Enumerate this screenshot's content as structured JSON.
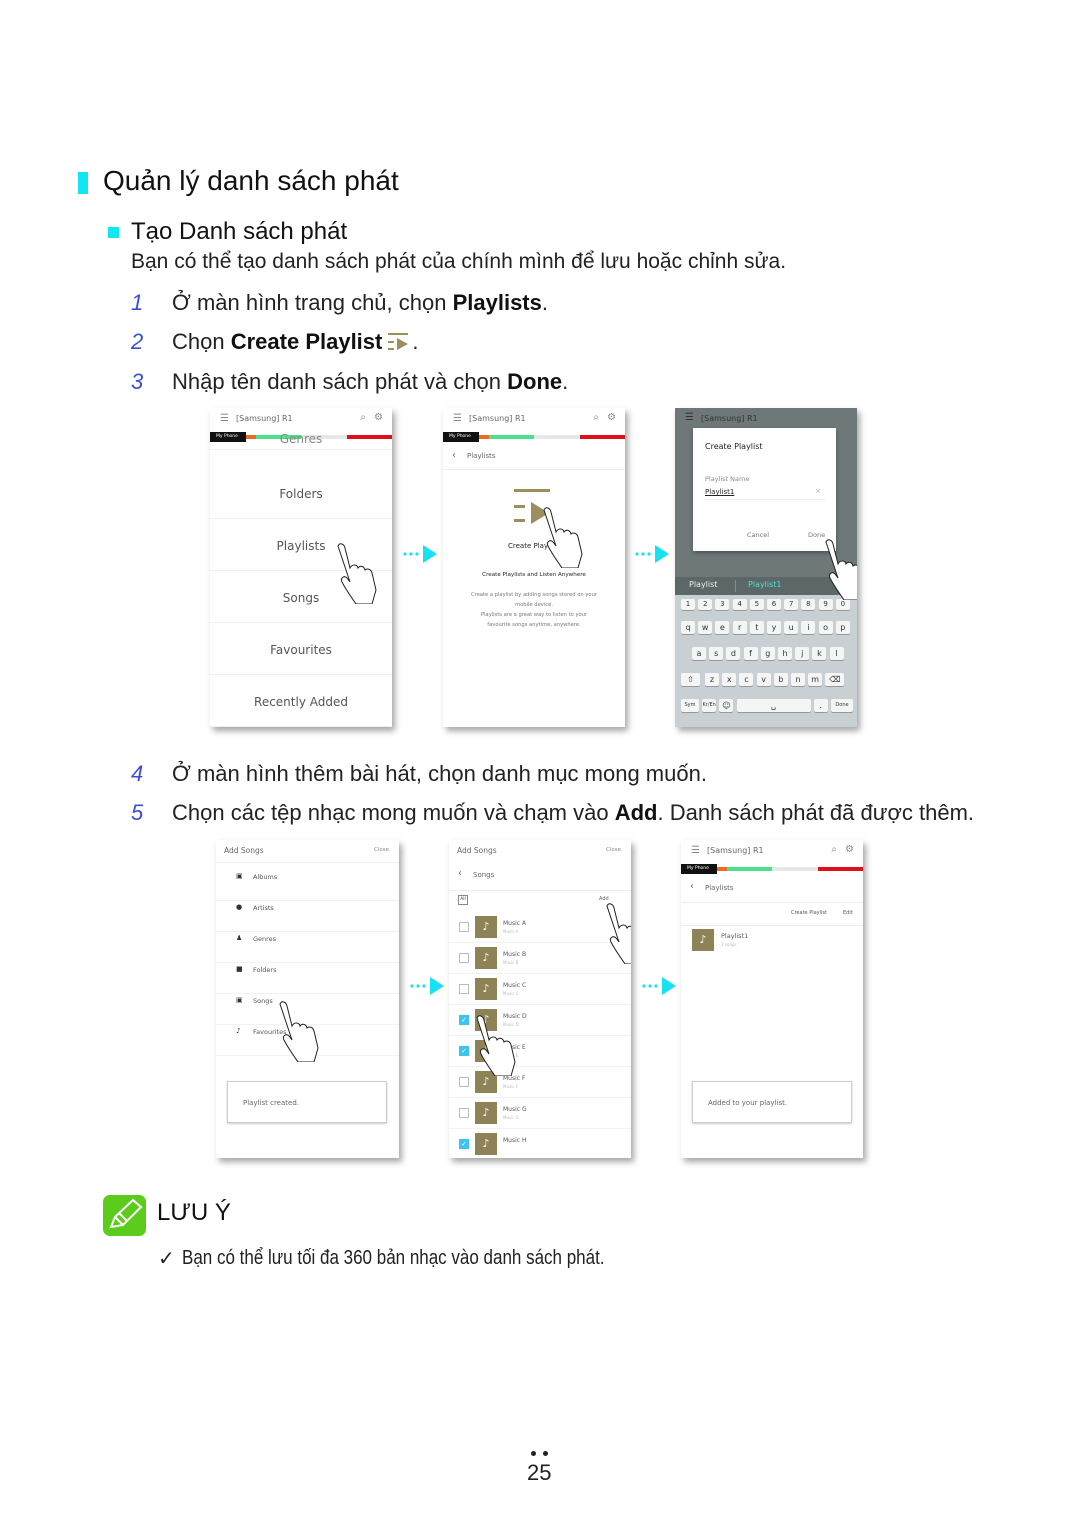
{
  "heading": "Quản lý danh sách phát",
  "subheading": "Tạo Danh sách phát",
  "intro": "Bạn có thể tạo danh sách phát của chính mình để lưu hoặc chỉnh sửa.",
  "steps": [
    {
      "num": "1",
      "pre": "Ở màn hình trang chủ, chọn ",
      "bold": "Playlists",
      "post": "."
    },
    {
      "num": "2",
      "pre": "Chọn ",
      "bold": "Create Playlist",
      "post": "."
    },
    {
      "num": "3",
      "pre": "Nhập tên danh sách phát và chọn ",
      "bold": "Done",
      "post": "."
    },
    {
      "num": "4",
      "pre": "Ở màn hình thêm bài hát, chọn danh mục mong muốn.",
      "bold": "",
      "post": ""
    },
    {
      "num": "5",
      "pre": "Chọn các tệp nhạc mong muốn và chạm vào ",
      "bold": "Add",
      "post": ". Danh sách phát đã được thêm."
    }
  ],
  "colors": {
    "accent": "#12e6f2",
    "step_number": "#3b4fd6",
    "bar": [
      "#f06a1e",
      "#4de08a",
      "#e4e8e9",
      "#e0101a"
    ],
    "thumb": "#8d8357",
    "check": "#3cc3ef"
  },
  "app_header": {
    "title": "[Samsung] R1",
    "tab": "My Phone",
    "icons": [
      "menu-icon",
      "search-icon",
      "gear-icon"
    ]
  },
  "screen1": {
    "items": [
      "Genres",
      "Folders",
      "Playlists",
      "Songs",
      "Favourites",
      "Recently Added"
    ]
  },
  "screen2": {
    "back": "Playlists",
    "button": "Create Playlist",
    "headline": "Create Playlists and Listen Anywhere",
    "body": [
      "Create a playlist by adding songs stored on your",
      "mobile device.",
      "Playlists are a great way to listen to your",
      "favourite songs anytime, anywhere."
    ]
  },
  "screen3": {
    "dialog_title": "Create Playlist",
    "field_label": "Playlist Name",
    "field_value": "Playlist1",
    "cancel": "Cancel",
    "done": "Done",
    "suggestions": [
      "Playlist",
      "Playlist1"
    ],
    "keys": [
      [
        "1",
        "2",
        "3",
        "4",
        "5",
        "6",
        "7",
        "8",
        "9",
        "0"
      ],
      [
        "q",
        "w",
        "e",
        "r",
        "t",
        "y",
        "u",
        "i",
        "o",
        "p"
      ],
      [
        "a",
        "s",
        "d",
        "f",
        "g",
        "h",
        "j",
        "k",
        "l"
      ],
      [
        "⇧",
        "z",
        "x",
        "c",
        "v",
        "b",
        "n",
        "m",
        "⌫"
      ],
      [
        "Sym",
        "Kr/En",
        "☺",
        "␣",
        ".",
        "Done"
      ]
    ]
  },
  "screen4": {
    "title": "Add Songs",
    "close": "Close",
    "items": [
      "Albums",
      "Artists",
      "Genres",
      "Folders",
      "Songs",
      "Favourites"
    ],
    "toast": "Playlist created."
  },
  "screen5": {
    "title": "Add Songs",
    "close": "Close",
    "back": "Songs",
    "all": "All",
    "add": "Add",
    "songs": [
      {
        "title": "Music A",
        "sub": "Music A",
        "checked": false
      },
      {
        "title": "Music B",
        "sub": "Music B",
        "checked": false
      },
      {
        "title": "Music C",
        "sub": "Music C",
        "checked": false
      },
      {
        "title": "Music D",
        "sub": "Music D",
        "checked": true
      },
      {
        "title": "Music E",
        "sub": "Music E",
        "checked": true
      },
      {
        "title": "Music F",
        "sub": "Music F",
        "checked": false
      },
      {
        "title": "Music G",
        "sub": "Music G",
        "checked": false
      },
      {
        "title": "Music H",
        "sub": "",
        "checked": true
      }
    ]
  },
  "screen6": {
    "back": "Playlists",
    "create": "Create Playlist",
    "edit": "Edit",
    "playlist": "Playlist1",
    "count": "3 songs",
    "toast": "Added to your playlist."
  },
  "note": {
    "title": "LƯU Ý",
    "text": "Bạn có thể lưu tối đa 360 bản nhạc vào danh sách phát."
  },
  "page_number": "25"
}
